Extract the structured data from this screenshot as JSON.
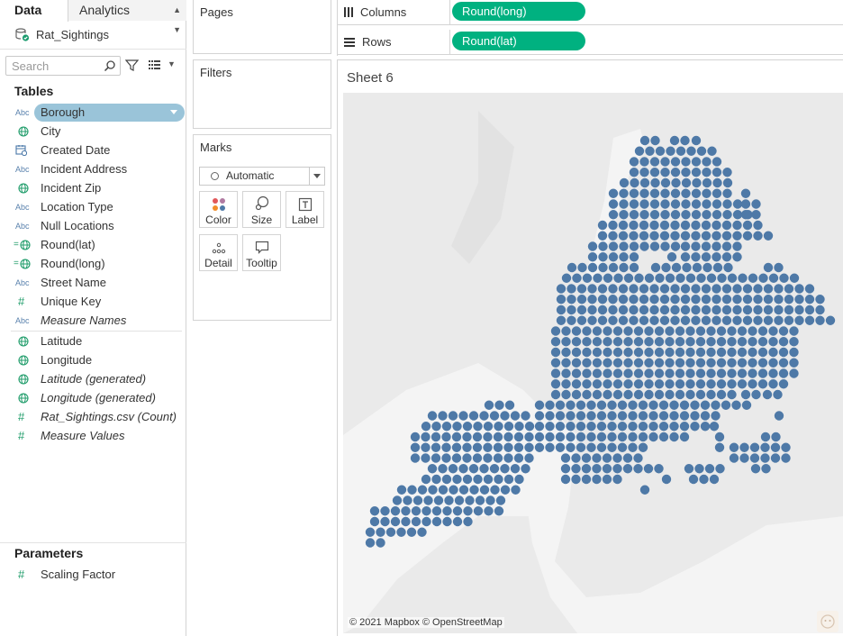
{
  "tabs": {
    "data": "Data",
    "analytics": "Analytics"
  },
  "datasource": {
    "name": "Rat_Sightings"
  },
  "search": {
    "placeholder": "Search"
  },
  "tables_title": "Tables",
  "fields": [
    {
      "icon": "abc",
      "label": "Borough"
    },
    {
      "icon": "globe",
      "label": "City"
    },
    {
      "icon": "calendar",
      "label": "Created Date"
    },
    {
      "icon": "abc",
      "label": "Incident Address"
    },
    {
      "icon": "globe",
      "label": "Incident Zip"
    },
    {
      "icon": "abc",
      "label": "Location Type"
    },
    {
      "icon": "abc",
      "label": "Null Locations"
    },
    {
      "icon": "globe-calc",
      "label": "Round(lat)"
    },
    {
      "icon": "globe-calc",
      "label": "Round(long)"
    },
    {
      "icon": "abc",
      "label": "Street Name"
    },
    {
      "icon": "hash",
      "label": "Unique Key"
    },
    {
      "icon": "abc",
      "label": "Measure Names"
    }
  ],
  "measures": [
    {
      "icon": "globe",
      "label": "Latitude"
    },
    {
      "icon": "globe",
      "label": "Longitude"
    },
    {
      "icon": "globe",
      "label": "Latitude (generated)"
    },
    {
      "icon": "globe",
      "label": "Longitude (generated)"
    },
    {
      "icon": "hash",
      "label": "Rat_Sightings.csv (Count)"
    },
    {
      "icon": "hash",
      "label": "Measure Values"
    }
  ],
  "parameters_title": "Parameters",
  "parameters": [
    {
      "icon": "hash",
      "label": "Scaling Factor"
    }
  ],
  "cards": {
    "pages": "Pages",
    "filters": "Filters",
    "marks": "Marks"
  },
  "marks": {
    "type": "Automatic",
    "buttons": {
      "color": "Color",
      "size": "Size",
      "label": "Label",
      "detail": "Detail",
      "tooltip": "Tooltip"
    }
  },
  "shelves": {
    "columns_label": "Columns",
    "columns_pill": "Round(long)",
    "rows_label": "Rows",
    "rows_pill": "Round(lat)"
  },
  "sheet": {
    "title": "Sheet 6"
  },
  "map": {
    "attribution": "© 2021 Mapbox © OpenStreetMap",
    "mark_color": "#4e79a7",
    "background_color": "#eaeaea"
  }
}
